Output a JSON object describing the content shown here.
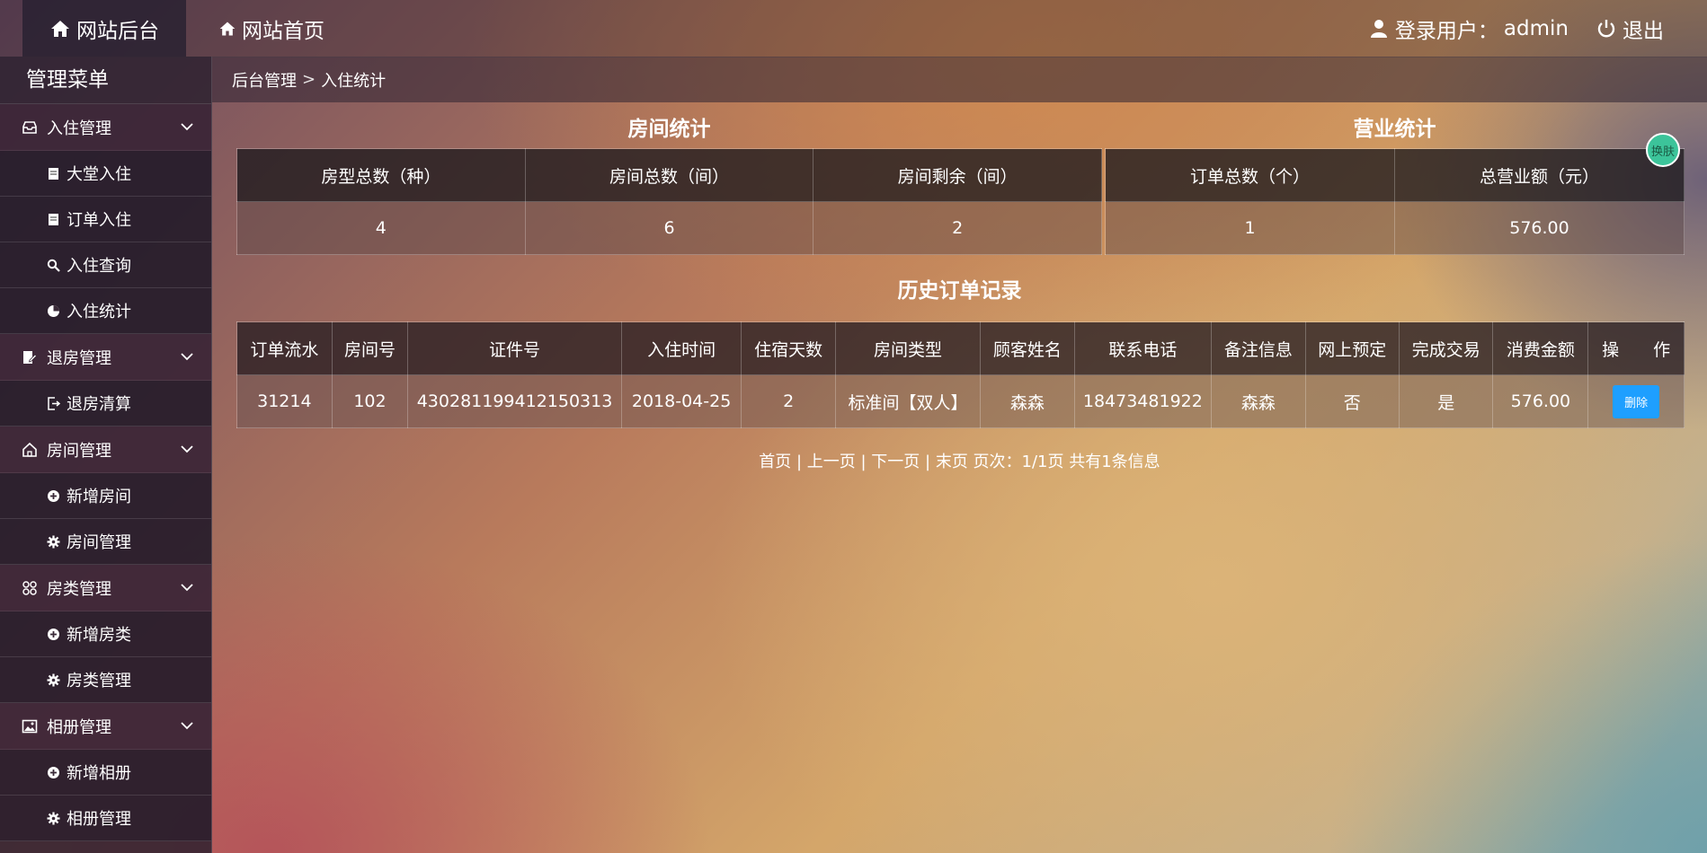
{
  "header": {
    "brand": "网站后台",
    "home_link": "网站首页",
    "user_label": "登录用户：",
    "user_name": "admin",
    "logout": "退出"
  },
  "sidebar": {
    "title": "管理菜单",
    "groups": [
      {
        "label": "入住管理",
        "items": [
          "大堂入住",
          "订单入住",
          "入住查询",
          "入住统计"
        ]
      },
      {
        "label": "退房管理",
        "items": [
          "退房清算"
        ]
      },
      {
        "label": "房间管理",
        "items": [
          "新增房间",
          "房间管理"
        ]
      },
      {
        "label": "房类管理",
        "items": [
          "新增房类",
          "房类管理"
        ]
      },
      {
        "label": "相册管理",
        "items": [
          "新增相册",
          "相册管理"
        ]
      }
    ]
  },
  "breadcrumb": {
    "root": "后台管理",
    "sep": ">",
    "current": "入住统计"
  },
  "room_stats": {
    "title": "房间统计",
    "headers": [
      "房型总数（种）",
      "房间总数（间）",
      "房间剩余（间）"
    ],
    "values": [
      "4",
      "6",
      "2"
    ]
  },
  "business_stats": {
    "title": "营业统计",
    "headers": [
      "订单总数（个）",
      "总营业额（元）"
    ],
    "values": [
      "1",
      "576.00"
    ]
  },
  "skin_button": "换肤",
  "history": {
    "title": "历史订单记录",
    "headers": [
      "订单流水",
      "房间号",
      "证件号",
      "入住时间",
      "住宿天数",
      "房间类型",
      "顾客姓名",
      "联系电话",
      "备注信息",
      "网上预定",
      "完成交易",
      "消费金额",
      "操　　作"
    ],
    "rows": [
      [
        "31214",
        "102",
        "430281199412150313",
        "2018-04-25",
        "2",
        "标准间【双人】",
        "森森",
        "18473481922",
        "森森",
        "否",
        "是",
        "576.00"
      ]
    ],
    "delete_label": "删除"
  },
  "pager": {
    "text": "首页 | 上一页 | 下一页 | 末页  页次：1/1页 共有1条信息"
  },
  "colors": {
    "delete_button": "#1e9fff",
    "skin_button": "#3cc49a"
  }
}
